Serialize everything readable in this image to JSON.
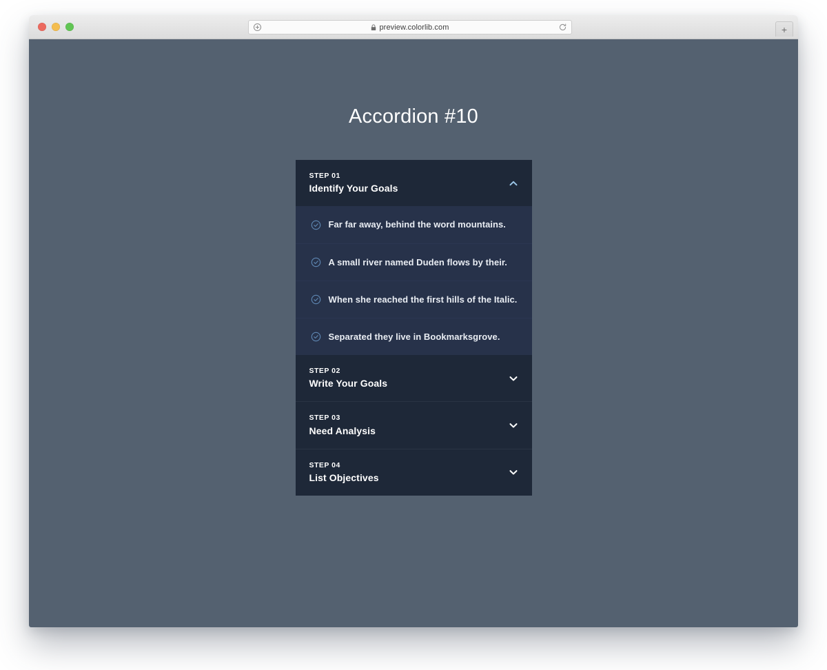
{
  "browser": {
    "traffic_lights": [
      "close",
      "minimize",
      "zoom"
    ],
    "url": "preview.colorlib.com",
    "secure_icon": "lock-icon",
    "left_icon": "site-info-icon",
    "reload_icon": "reload-icon",
    "new_tab_label": "+"
  },
  "page": {
    "title": "Accordion #10",
    "background_color": "#546170",
    "panel_header_color": "#1e2838",
    "panel_body_color": "#27324a",
    "accent_color": "#9cc7e8",
    "check_color": "#5f88b4"
  },
  "accordion": {
    "sections": [
      {
        "step": "STEP 01",
        "title": "Identify Your Goals",
        "expanded": true,
        "chevron": "chevron-up-icon",
        "items": [
          {
            "icon": "check-circle-icon",
            "text": "Far far away, behind the word mountains."
          },
          {
            "icon": "check-circle-icon",
            "text": "A small river named Duden flows by their."
          },
          {
            "icon": "check-circle-icon",
            "text": "When she reached the first hills of the Italic."
          },
          {
            "icon": "check-circle-icon",
            "text": "Separated they live in Bookmarksgrove."
          }
        ]
      },
      {
        "step": "STEP 02",
        "title": "Write Your Goals",
        "expanded": false,
        "chevron": "chevron-down-icon",
        "items": []
      },
      {
        "step": "STEP 03",
        "title": "Need Analysis",
        "expanded": false,
        "chevron": "chevron-down-icon",
        "items": []
      },
      {
        "step": "STEP 04",
        "title": "List Objectives",
        "expanded": false,
        "chevron": "chevron-down-icon",
        "items": []
      }
    ]
  }
}
